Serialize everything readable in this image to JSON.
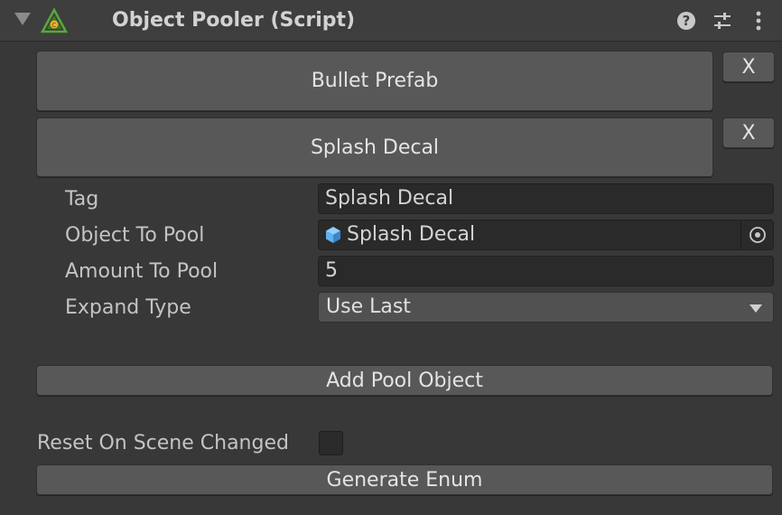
{
  "component": {
    "title": "Object Pooler (Script)",
    "icons": [
      "foldout-arrow",
      "script-icon",
      "help-icon",
      "preset-icon",
      "kebab-menu-icon"
    ]
  },
  "pool_items": [
    {
      "label": "Bullet Prefab",
      "remove_label": "X"
    },
    {
      "label": "Splash Decal",
      "remove_label": "X"
    }
  ],
  "expanded_item": {
    "tag_label": "Tag",
    "tag_value": "Splash Decal",
    "object_label": "Object To Pool",
    "object_value": "Splash Decal",
    "amount_label": "Amount To Pool",
    "amount_value": "5",
    "expand_label": "Expand Type",
    "expand_value": "Use Last"
  },
  "add_button": "Add Pool Object",
  "reset_label": "Reset On Scene Changed",
  "reset_checked": false,
  "generate_button": "Generate Enum",
  "colors": {
    "panel_bg": "#383838",
    "header_bg": "#3e3e3e",
    "button_bg": "#585858",
    "field_bg": "#2a2a2a",
    "cube_icon": "#5fb3f0"
  }
}
